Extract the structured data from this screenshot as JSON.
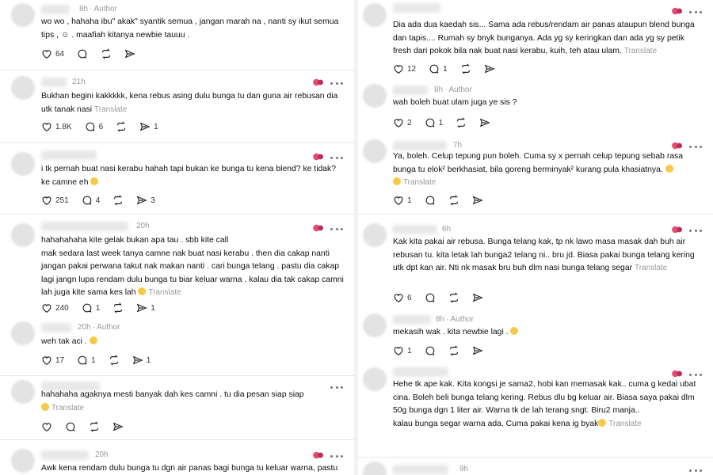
{
  "left": [
    {
      "time": "8h",
      "author": "Author",
      "text": "wo wo , hahaha ibu\" akak\" syantik semua , jangan marah na , nanti sy ikut semua tips , ☺ . maafiah kitanya newbie tauuu .",
      "likes": "64",
      "replies": "",
      "reposts": "",
      "shares": ""
    },
    {
      "time": "21h",
      "author": "",
      "text": "Bukhan begini kakkkkk, kena rebus asing dulu bunga tu dan guna air rebusan dia utk tanak nasi",
      "translate": "Translate",
      "likes": "1.8K",
      "replies": "6",
      "reposts": "",
      "shares": "1"
    },
    {
      "time": "",
      "author": "",
      "text": "i tk pernah buat nasi kerabu hahah tapi bukan ke bunga tu kena blend? ke tidak? ke camne eh",
      "likes": "251",
      "replies": "4",
      "reposts": "",
      "shares": "3"
    },
    {
      "time": "20h",
      "author": "",
      "text": "hahahahaha kite gelak bukan apa tau . sbb kite call\nmak sedara last week tanya camne nak buat nasi kerabu . then dia cakap nanti jangan pakai perwana takut nak makan nanti . cari bunga telang . pastu dia cakap lagi jangn lupa rendam dulu bunga tu biar keluar warna . kalau dia tak cakap camni lah juga kite sama kes lah",
      "translate": "Translate",
      "likes": "240",
      "replies": "1",
      "reposts": "",
      "shares": "1"
    },
    {
      "time": "20h",
      "author": "Author",
      "text": "weh tak aci .",
      "likes": "17",
      "replies": "1",
      "reposts": "",
      "shares": "1"
    },
    {
      "time": "",
      "author": "",
      "text": "hahahaha agaknya mesti banyak dah kes camni . tu dia pesan siap siap",
      "translate": "Translate",
      "likes": "",
      "replies": "",
      "reposts": "",
      "shares": ""
    },
    {
      "time": "20h",
      "author": "",
      "text": "Awk kena rendam dulu bunga tu dgn air panas bagi bunga tu keluar warna, pastu",
      "likes": "",
      "replies": "",
      "reposts": "",
      "shares": ""
    }
  ],
  "right": [
    {
      "time": "",
      "author": "",
      "text": "Dia ada dua kaedah sis... Sama ada rebus/rendam air panas ataupun blend bunga dan tapis.... Rumah sy bnyk bunganya. Ada yg sy keringkan dan ada yg sy petik fresh dari pokok bila nak buat nasi kerabu, kuih, teh atau ulam.",
      "translate": "Translate",
      "likes": "12",
      "replies": "1",
      "reposts": "",
      "shares": ""
    },
    {
      "time": "8h",
      "author": "Author",
      "text": "wah boleh buat ulam juga ye sis ?",
      "likes": "2",
      "replies": "1",
      "reposts": "",
      "shares": ""
    },
    {
      "time": "7h",
      "author": "",
      "text": "Ya, boleh. Celup tepung pun boleh. Cuma sy x pernah celup tepung sebab rasa bunga tu elok² berkhasiat, bila goreng berminyak² kurang pula khasiatnya.",
      "translate": "Translate",
      "likes": "1",
      "replies": "",
      "reposts": "",
      "shares": ""
    },
    {
      "time": "6h",
      "author": "",
      "text": "Kak kita pakai air rebusa. Bunga telang kak, tp nk lawo masa masak dah buh air rebusan tu. kita letak lah bunga2 telang ni.. bru jd. Biasa pakai bunga telang kering utk dpt kan air. Nti nk masak bru buh dlm nasi bunga telang segar",
      "translate": "Translate",
      "likes": "6",
      "replies": "",
      "reposts": "",
      "shares": ""
    },
    {
      "time": "8h",
      "author": "Author",
      "text": "mekasih wak . kita newbie lagi .",
      "likes": "1",
      "replies": "",
      "reposts": "",
      "shares": ""
    },
    {
      "time": "",
      "author": "",
      "text": "Hehe tk ape kak. Kita kongsi je sama2, hobi kan memasak kak.. cuma g kedai ubat cina. Boleh beli bunga telang kering. Rebus dlu bg keluar air. Biasa saya pakai dlm 50g bunga dgn 1 liter air. Warna tk de lah terang sngt. Biru2 manja..\nkalau bunga segar warna ada. Cuma pakai kena ig byak",
      "translate": "Translate",
      "likes": "",
      "replies": "",
      "reposts": "",
      "shares": ""
    },
    {
      "time": "9h",
      "author": "",
      "text": "",
      "likes": "",
      "replies": "",
      "reposts": "",
      "shares": ""
    }
  ]
}
